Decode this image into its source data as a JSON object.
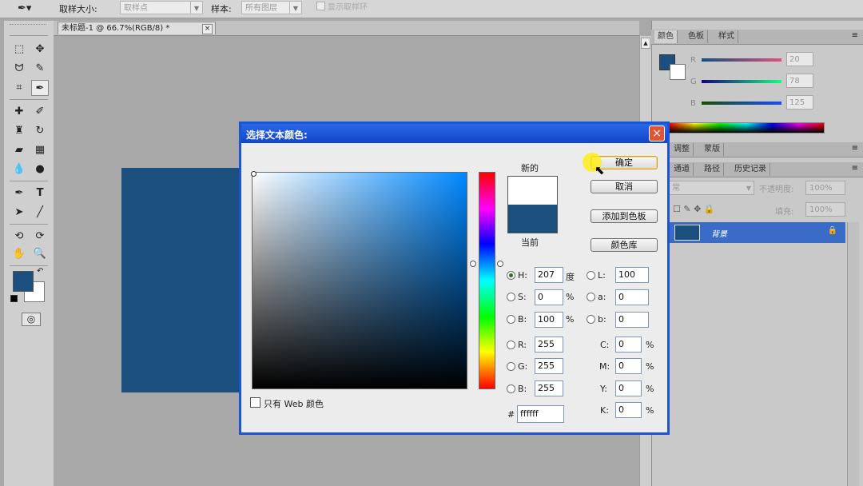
{
  "options_bar": {
    "sample_size_label": "取样大小:",
    "sample_size_value": "取样点",
    "sample_label": "样本:",
    "sample_value": "所有图层",
    "show_ring_label": "显示取样环"
  },
  "document": {
    "tab_title": "未标题-1 @ 66.7%(RGB/8) *",
    "canvas_color": "#1b4f7e"
  },
  "panels": {
    "color_tabs": [
      "颜色",
      "色板",
      "样式"
    ],
    "rgb_values": [
      "20",
      "78",
      "125"
    ],
    "adjust_tabs": [
      "调整",
      "蒙版"
    ],
    "layer_tabs": [
      "通道",
      "路径",
      "历史记录"
    ],
    "opacity_label": "不透明度:",
    "opacity_value": "100%",
    "fill_label": "填充:",
    "fill_value": "100%",
    "blend_mode": "常",
    "layer_name": "背景"
  },
  "toolbox": {
    "foreground_color": "#1b4f7e",
    "background_color": "#ffffff"
  },
  "dialog": {
    "title": "选择文本颜色:",
    "new_label": "新的",
    "current_label": "当前",
    "new_color": "#ffffff",
    "current_color": "#1b4f7e",
    "ok_button": "确定",
    "cancel_button": "取消",
    "add_swatch_button": "添加到色板",
    "color_library_button": "颜色库",
    "web_only_label": "只有 Web 颜色",
    "hsb": [
      {
        "label": "H:",
        "value": "207",
        "unit": "度",
        "selected": true
      },
      {
        "label": "S:",
        "value": "0",
        "unit": "%"
      },
      {
        "label": "B:",
        "value": "100",
        "unit": "%"
      }
    ],
    "lab": [
      {
        "label": "L:",
        "value": "100"
      },
      {
        "label": "a:",
        "value": "0"
      },
      {
        "label": "b:",
        "value": "0"
      }
    ],
    "rgb": [
      {
        "label": "R:",
        "value": "255"
      },
      {
        "label": "G:",
        "value": "255"
      },
      {
        "label": "B:",
        "value": "255"
      }
    ],
    "cmyk": [
      {
        "label": "C:",
        "value": "0",
        "unit": "%"
      },
      {
        "label": "M:",
        "value": "0",
        "unit": "%"
      },
      {
        "label": "Y:",
        "value": "0",
        "unit": "%"
      },
      {
        "label": "K:",
        "value": "0",
        "unit": "%"
      }
    ],
    "hex_label": "#",
    "hex_value": "ffffff"
  }
}
